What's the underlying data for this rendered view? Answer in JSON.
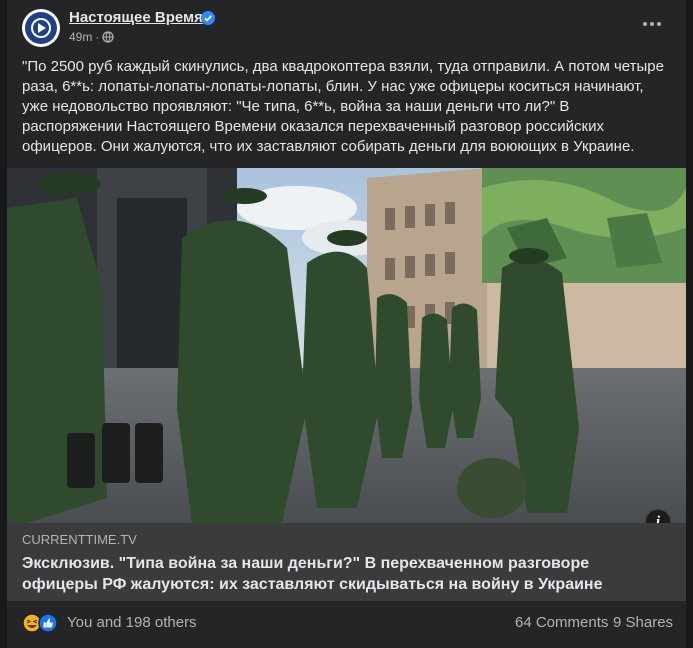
{
  "post": {
    "page_name": "Настоящее Время",
    "time": "49m",
    "text": "\"По 2500 руб каждый скинулись, два квадрокоптера взяли, туда отправили. А потом четыре раза, 6**ь: лопаты-лопаты-лопаты-лопаты, блин. У нас уже офицеры коситься начинают, уже недовольство проявляют: \"Че типа, 6**ь, война за наши деньги что ли?\" В распоряжении Настоящего Времени оказался перехваченный разговор российских офицеров. Они жалуются, что их заставляют собирать деньги для воюющих в Украине."
  },
  "link": {
    "domain": "CURRENTTIME.TV",
    "title": "Эксклюзив. \"Типа война за наши деньги?\" В перехваченном разговоре офицеры РФ жалуются: их заставляют скидываться на войну в Украине"
  },
  "info_label": "i",
  "footer": {
    "reactions": "You and 198 others",
    "comments": "64 Comments",
    "shares": "9 Shares"
  },
  "icons": [
    "page-logo-icon",
    "verified-badge-icon",
    "globe-icon",
    "more-options-icon",
    "info-icon",
    "haha-reaction-icon",
    "like-reaction-icon"
  ],
  "colors": {
    "background": "#18191a",
    "card": "#242526",
    "link_box": "#3a3b3c",
    "verified": "#2d88ff",
    "logo": "#1e3f8a"
  }
}
